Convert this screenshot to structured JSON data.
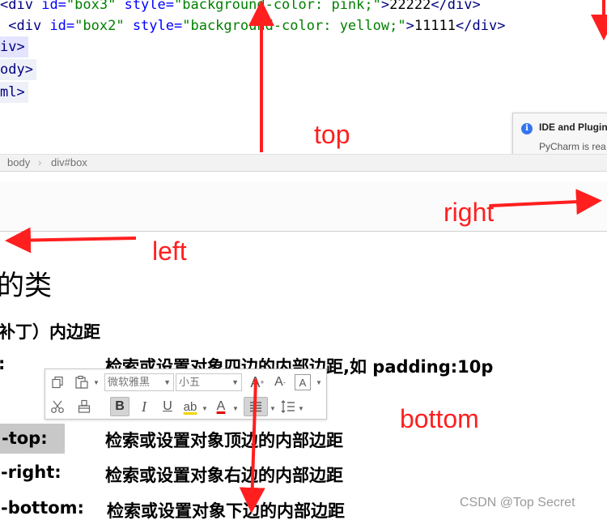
{
  "editor": {
    "lines": [
      {
        "lead": "<",
        "tag": "div ",
        "attr1": "id=",
        "val1": "\"box3\"",
        "attr2": " style=",
        "val2": "\"background-color: pink;\"",
        "close": ">",
        "text": "22222",
        "end": "</div>"
      },
      {
        "lead": " <",
        "tag": "div ",
        "attr1": "id=",
        "val1": "\"box2\"",
        "attr2": " style=",
        "val2": "\"background-color: yellow;\"",
        "close": ">",
        "text": "11111",
        "end": "</div>"
      }
    ],
    "fragments": [
      "iv>",
      "ody>",
      "ml>"
    ],
    "notification": {
      "title": "IDE and Plugin",
      "body": "PyCharm is rea"
    },
    "breadcrumb": [
      "body",
      "div#box"
    ]
  },
  "document": {
    "heading_fragment": "的类",
    "subheading": "补丁）内边距",
    "rows": [
      {
        "prop": ":",
        "desc": "检索或设置对象四边的内部边距,如 padding:10p"
      },
      {
        "prop": "-top:",
        "desc": "检索或设置对象顶边的内部边距"
      },
      {
        "prop": "-right:",
        "desc": "检索或设置对象右边的内部边距"
      },
      {
        "prop": "-bottom:",
        "desc": "检索或设置对象下边的内部边距"
      }
    ]
  },
  "toolbar": {
    "font_name": "微软雅黑",
    "font_size": "小五",
    "icons": [
      "copy-icon",
      "paste-icon",
      "grow-font-icon",
      "shrink-font-icon",
      "format-icon",
      "cut-icon",
      "format-painter-icon",
      "bold-icon",
      "italic-icon",
      "underline-icon",
      "highlight-icon",
      "font-color-icon",
      "align-icon",
      "line-spacing-icon"
    ],
    "glyphs": {
      "bold": "B",
      "italic": "I",
      "underline": "U",
      "highlight": "ab",
      "font_color": "A",
      "grow": "A",
      "shrink": "A",
      "grow_sup": "+",
      "shrink_sup": "-",
      "format": "A"
    }
  },
  "annotations": {
    "top": "top",
    "right": "right",
    "left": "left",
    "bottom": "bottom",
    "color": "#ff1f1f"
  },
  "watermark": "CSDN @Top Secret"
}
